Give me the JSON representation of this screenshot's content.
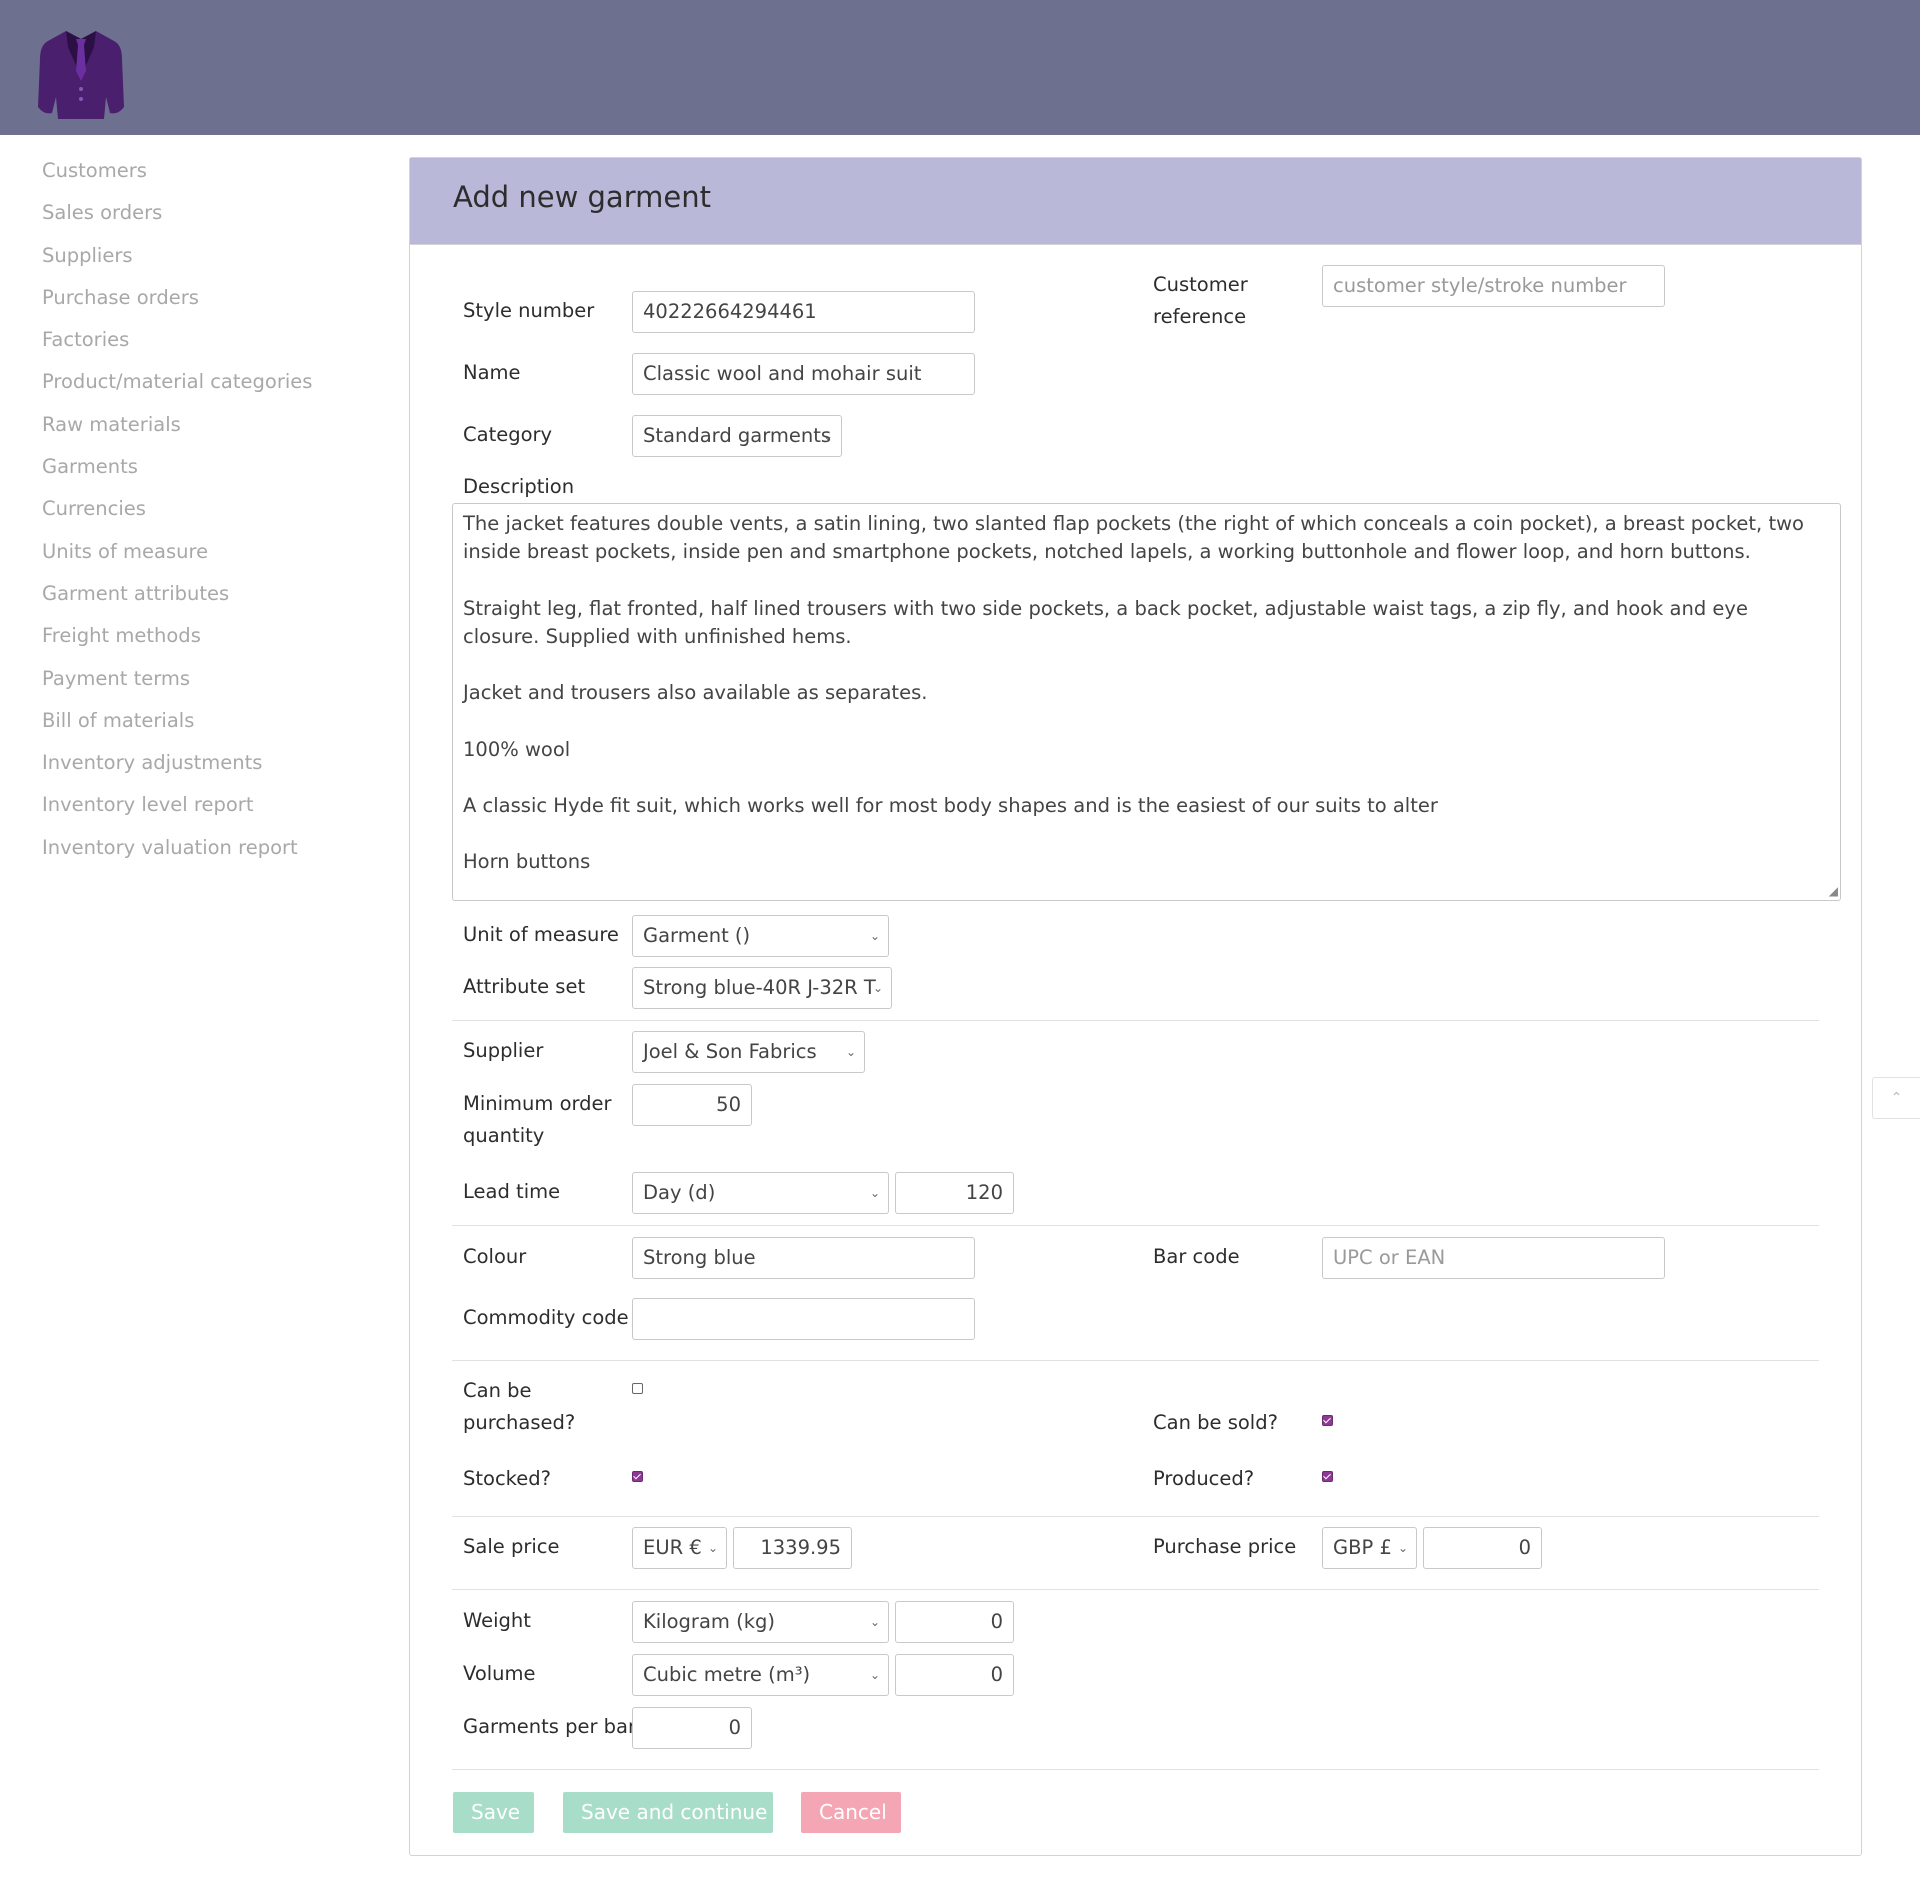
{
  "brand": {
    "logo_icon": "suit-jacket-icon"
  },
  "sidebar": {
    "items": [
      {
        "label": "Customers"
      },
      {
        "label": "Sales orders"
      },
      {
        "label": "Suppliers"
      },
      {
        "label": "Purchase orders"
      },
      {
        "label": "Factories"
      },
      {
        "label": "Product/material categories"
      },
      {
        "label": "Raw materials"
      },
      {
        "label": "Garments"
      },
      {
        "label": "Currencies"
      },
      {
        "label": "Units of measure"
      },
      {
        "label": "Garment attributes"
      },
      {
        "label": "Freight methods"
      },
      {
        "label": "Payment terms"
      },
      {
        "label": "Bill of materials"
      },
      {
        "label": "Inventory adjustments"
      },
      {
        "label": "Inventory level report"
      },
      {
        "label": "Inventory valuation report"
      }
    ]
  },
  "form": {
    "title": "Add new garment",
    "style_number": {
      "label": "Style number",
      "value": "40222664294461"
    },
    "customer_reference": {
      "label_line1": "Customer",
      "label_line2": "reference",
      "value": "",
      "placeholder": "customer style/stroke number"
    },
    "name": {
      "label": "Name",
      "value": "Classic wool and mohair suit"
    },
    "category": {
      "label": "Category",
      "selected": "Standard garments"
    },
    "description": {
      "label": "Description",
      "paragraphs": [
        "The jacket features double vents, a satin lining, two slanted flap pockets (the right of which conceals a coin pocket), a breast pocket, two inside breast pockets, inside pen and smartphone pockets, notched lapels, a working buttonhole and flower loop, and horn buttons.",
        "Straight leg, flat fronted, half lined trousers with two side pockets, a back pocket, adjustable waist tags, a zip fly, and hook and eye closure. Supplied with unfinished hems.",
        "Jacket and trousers also available as separates.",
        "100% wool",
        "A classic Hyde fit suit, which works well for most body shapes and is the easiest of our suits to alter",
        "Horn buttons"
      ]
    },
    "unit_of_measure": {
      "label": "Unit of measure",
      "selected": "Garment ()"
    },
    "attribute_set": {
      "label": "Attribute set",
      "selected": "Strong blue-40R J-32R T"
    },
    "supplier": {
      "label": "Supplier",
      "selected": "Joel & Son Fabrics"
    },
    "minimum_order_quantity": {
      "label_line1": "Minimum order",
      "label_line2": "quantity",
      "value": "50"
    },
    "lead_time": {
      "label": "Lead time",
      "unit": "Day (d)",
      "value": "120"
    },
    "colour": {
      "label": "Colour",
      "value": "Strong blue"
    },
    "bar_code": {
      "label": "Bar code",
      "value": "",
      "placeholder": "UPC or EAN"
    },
    "commodity_code": {
      "label": "Commodity code",
      "value": ""
    },
    "can_be_purchased": {
      "label_line1": "Can be",
      "label_line2": "purchased?",
      "checked": false
    },
    "can_be_sold": {
      "label": "Can be sold?",
      "checked": true
    },
    "stocked": {
      "label": "Stocked?",
      "checked": true
    },
    "produced": {
      "label": "Produced?",
      "checked": true
    },
    "sale_price": {
      "label": "Sale price",
      "currency": "EUR €",
      "value": "1339.95"
    },
    "purchase_price": {
      "label": "Purchase price",
      "currency": "GBP £",
      "value": "0"
    },
    "weight": {
      "label": "Weight",
      "unit": "Kilogram (kg)",
      "value": "0"
    },
    "volume": {
      "label": "Volume",
      "unit": "Cubic metre (m³)",
      "value": "0"
    },
    "garments_per_bar": {
      "label": "Garments per bar",
      "value": "0"
    },
    "buttons": {
      "save": "Save",
      "save_continue": "Save and continue",
      "cancel": "Cancel"
    }
  },
  "scroll_top": {
    "icon": "chevron-up-icon",
    "glyph": "⌃"
  },
  "colors": {
    "header": "#6e708f",
    "panel_header": "#b9b8d9",
    "accent": "#8e3a94",
    "save": "#a8ddc9",
    "cancel": "#f5a6b5"
  }
}
